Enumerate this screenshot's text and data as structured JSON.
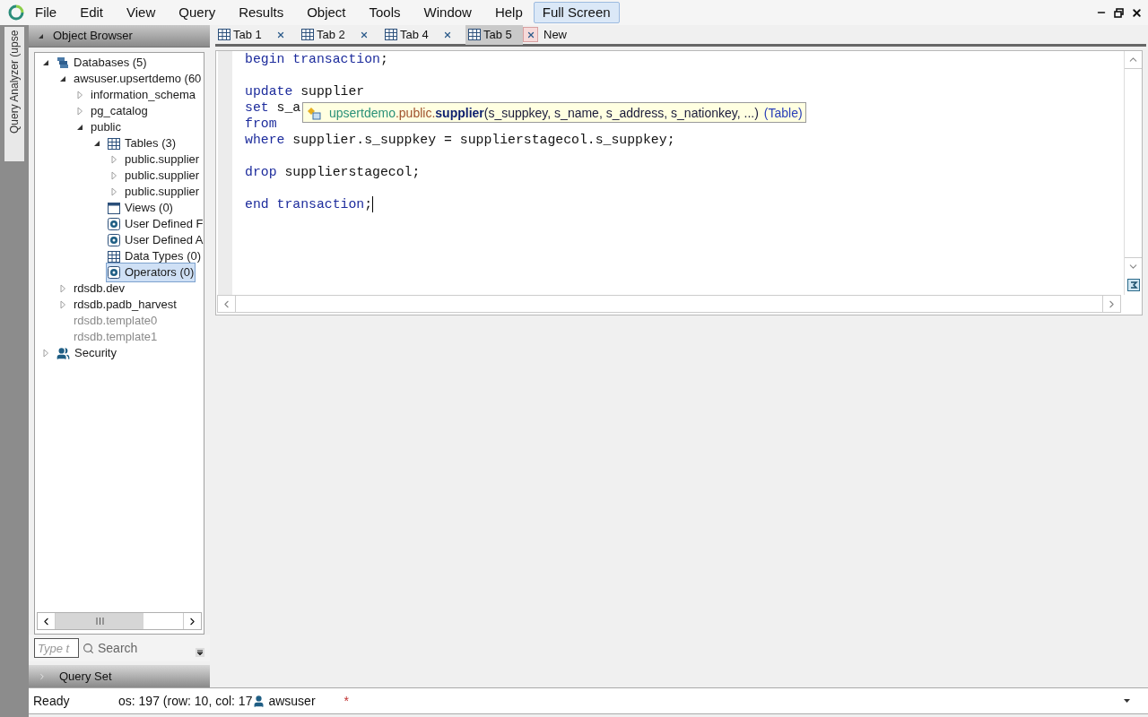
{
  "menu": [
    {
      "label": "File"
    },
    {
      "label": "Edit"
    },
    {
      "label": "View"
    },
    {
      "label": "Query"
    },
    {
      "label": "Results"
    },
    {
      "label": "Object"
    },
    {
      "label": "Tools"
    },
    {
      "label": "Window"
    },
    {
      "label": "Help"
    }
  ],
  "full_screen_button": {
    "label": "Full Screen",
    "selected": true
  },
  "side_strip": {
    "label": "Query Analyzer (upse"
  },
  "object_browser": {
    "title": "Object Browser",
    "tree": [
      {
        "label": "Databases (5)",
        "kind": "database",
        "expanded": true,
        "selected": false,
        "disabled": false,
        "children": [
          {
            "label": "awsuser.upsertdemo (60",
            "expanded": true,
            "selected": false,
            "disabled": false,
            "children": [
              {
                "label": "information_schema",
                "expanded": false,
                "selected": false,
                "disabled": false
              },
              {
                "label": "pg_catalog",
                "expanded": false,
                "selected": false,
                "disabled": false
              },
              {
                "label": "public",
                "expanded": true,
                "selected": false,
                "disabled": false,
                "children": [
                  {
                    "label": "Tables (3)",
                    "kind": "table",
                    "expanded": true,
                    "selected": false,
                    "disabled": false,
                    "children": [
                      {
                        "label": "public.supplier",
                        "expanded": false,
                        "selected": false,
                        "disabled": false
                      },
                      {
                        "label": "public.supplier",
                        "expanded": false,
                        "selected": false,
                        "disabled": false
                      },
                      {
                        "label": "public.supplier",
                        "expanded": false,
                        "selected": false,
                        "disabled": false
                      }
                    ]
                  },
                  {
                    "label": "Views (0)",
                    "kind": "view",
                    "selected": false,
                    "disabled": false
                  },
                  {
                    "label": "User Defined F",
                    "kind": "function",
                    "selected": false,
                    "disabled": false
                  },
                  {
                    "label": "User Defined A",
                    "kind": "function",
                    "selected": false,
                    "disabled": false
                  },
                  {
                    "label": "Data Types (0)",
                    "kind": "table",
                    "selected": false,
                    "disabled": false
                  },
                  {
                    "label": "Operators (0)",
                    "kind": "function",
                    "selected": true,
                    "disabled": false
                  }
                ]
              }
            ]
          },
          {
            "label": "rdsdb.dev",
            "expanded": false,
            "selected": false,
            "disabled": false
          },
          {
            "label": "rdsdb.padb_harvest",
            "expanded": false,
            "selected": false,
            "disabled": false
          },
          {
            "label": "rdsdb.template0",
            "selected": false,
            "disabled": true
          },
          {
            "label": "rdsdb.template1",
            "selected": false,
            "disabled": true
          }
        ]
      },
      {
        "label": "Security",
        "kind": "security",
        "expanded": false,
        "selected": false,
        "disabled": false
      }
    ],
    "search": {
      "placeholder": "Type t",
      "button": "Search"
    },
    "query_set": {
      "title": "Query Set",
      "expanded": false
    }
  },
  "tabs": [
    {
      "label": "Tab 1",
      "selected": false
    },
    {
      "label": "Tab 2",
      "selected": false
    },
    {
      "label": "Tab 4",
      "selected": false
    },
    {
      "label": "Tab 5",
      "selected": true
    }
  ],
  "new_tab": "New",
  "editor": {
    "blocks": [
      {
        "lines": [
          [
            {
              "kind": "keyword",
              "text": "begin transaction"
            },
            {
              "kind": "text",
              "text": ";"
            }
          ]
        ]
      },
      {
        "lines": [
          [
            {
              "kind": "keyword",
              "text": "update"
            },
            {
              "kind": "text",
              "text": " supplier"
            }
          ],
          [
            {
              "kind": "keyword",
              "text": "set"
            },
            {
              "kind": "text",
              "text": " s_a"
            }
          ],
          [
            {
              "kind": "keyword",
              "text": "from"
            }
          ],
          [
            {
              "kind": "keyword",
              "text": "where"
            },
            {
              "kind": "text",
              "text": " supplier.s_suppkey = supplierstagecol.s_suppkey;"
            }
          ]
        ]
      },
      {
        "lines": [
          [
            {
              "kind": "keyword",
              "text": "drop"
            },
            {
              "kind": "text",
              "text": " supplierstagecol;"
            }
          ]
        ]
      },
      {
        "lines": [
          [
            {
              "kind": "keyword",
              "text": "end transaction"
            },
            {
              "kind": "text",
              "text": ";"
            }
          ]
        ]
      }
    ],
    "tooltip": [
      {
        "kind": "database",
        "text": "upsertdemo"
      },
      {
        "kind": "schema",
        "text": ".public."
      },
      {
        "kind": "object",
        "text": "supplier"
      },
      {
        "kind": "args",
        "text": "(s_suppkey, s_name, s_address, s_nationkey, ...)"
      },
      {
        "kind": "type",
        "text": "(Table)"
      }
    ]
  },
  "status_bar": {
    "state": "Ready",
    "position": "os: 197 (row: 10, col: 17",
    "user": "awsuser",
    "modified": "*"
  }
}
